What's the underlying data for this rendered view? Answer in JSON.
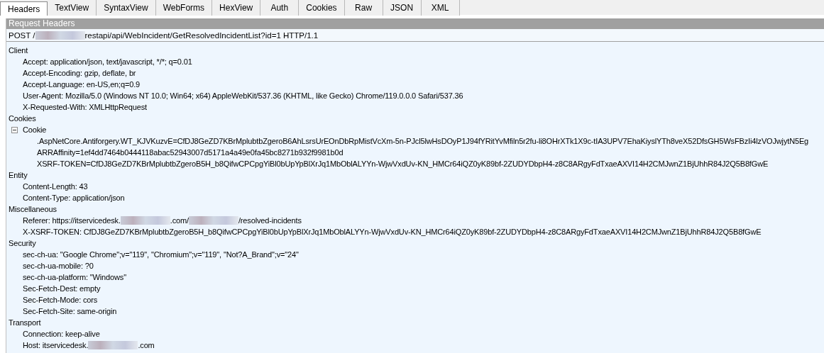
{
  "tabs": [
    {
      "label": "Headers",
      "selected": true
    },
    {
      "label": "TextView",
      "selected": false
    },
    {
      "label": "SyntaxView",
      "selected": false
    },
    {
      "label": "WebForms",
      "selected": false
    },
    {
      "label": "HexView",
      "selected": false
    },
    {
      "label": "Auth",
      "selected": false
    },
    {
      "label": "Cookies",
      "selected": false
    },
    {
      "label": "Raw",
      "selected": false
    },
    {
      "label": "JSON",
      "selected": false
    },
    {
      "label": "XML",
      "selected": false
    }
  ],
  "section_title": "Request Headers",
  "request_line": {
    "segments": [
      "POST /",
      "restapi/api/WebIncident/GetResolvedIncidentList?id=1 HTTP/1.1"
    ]
  },
  "groups": [
    {
      "name": "Client",
      "children": [
        {
          "text": "Accept: application/json, text/javascript, */*; q=0.01"
        },
        {
          "text": "Accept-Encoding: gzip, deflate, br"
        },
        {
          "text": "Accept-Language: en-US,en;q=0.9"
        },
        {
          "text": "User-Agent: Mozilla/5.0 (Windows NT 10.0; Win64; x64) AppleWebKit/537.36 (KHTML, like Gecko) Chrome/119.0.0.0 Safari/537.36"
        },
        {
          "text": "X-Requested-With: XMLHttpRequest"
        }
      ]
    },
    {
      "name": "Cookies",
      "children": [
        {
          "text": "Cookie",
          "expanded": true,
          "children": [
            {
              "text": ".AspNetCore.Antiforgery.WT_KJVKuzvE=CfDJ8GeZD7KBrMplubtbZgeroB6AhLsrsUrEOnDbRpMistVcXm-5n-PJcl5lwHsDOyP1J94fYRitYvMfiln5r2fu-li8OHrXTk1X9c-tIA3UPV7EhaKiyslYTh8veX52DfsGH5WsFBzIi4lzVOJwjytN5Eg"
            },
            {
              "text": "ARRAffinity=1ef4dd7464b0444118abac52943007d5171a4a49e0fa45bc8271b932f9981b0d"
            },
            {
              "text": "XSRF-TOKEN=CfDJ8GeZD7KBrMplubtbZgeroB5H_b8QifwCPCpgYiBl0bUpYpBlXrJq1MbOblALYYn-WjwVxdUv-KN_HMCr64iQZ0yK89bf-2ZUDYDbpH4-z8C8ARgyFdTxaeAXVI14H2CMJwnZ1BjUhhR84J2Q5B8fGwE"
            }
          ]
        }
      ]
    },
    {
      "name": "Entity",
      "children": [
        {
          "text": "Content-Length: 43"
        },
        {
          "text": "Content-Type: application/json"
        }
      ]
    },
    {
      "name": "Miscellaneous",
      "children": [
        {
          "segments": [
            "Referer: https://itservicedesk.",
            ".com/",
            "/resolved-incidents"
          ]
        },
        {
          "text": "X-XSRF-TOKEN: CfDJ8GeZD7KBrMplubtbZgeroB5H_b8QifwCPCpgYiBl0bUpYpBlXrJq1MbOblALYYn-WjwVxdUv-KN_HMCr64iQZ0yK89bf-2ZUDYDbpH4-z8C8ARgyFdTxaeAXVI14H2CMJwnZ1BjUhhR84J2Q5B8fGwE"
        }
      ]
    },
    {
      "name": "Security",
      "children": [
        {
          "text": "sec-ch-ua: \"Google Chrome\";v=\"119\", \"Chromium\";v=\"119\", \"Not?A_Brand\";v=\"24\""
        },
        {
          "text": "sec-ch-ua-mobile: ?0"
        },
        {
          "text": "sec-ch-ua-platform: \"Windows\""
        },
        {
          "text": "Sec-Fetch-Dest: empty"
        },
        {
          "text": "Sec-Fetch-Mode: cors"
        },
        {
          "text": "Sec-Fetch-Site: same-origin"
        }
      ]
    },
    {
      "name": "Transport",
      "children": [
        {
          "text": "Connection: keep-alive"
        },
        {
          "segments": [
            "Host: itservicedesk.",
            ".com"
          ]
        }
      ]
    }
  ]
}
